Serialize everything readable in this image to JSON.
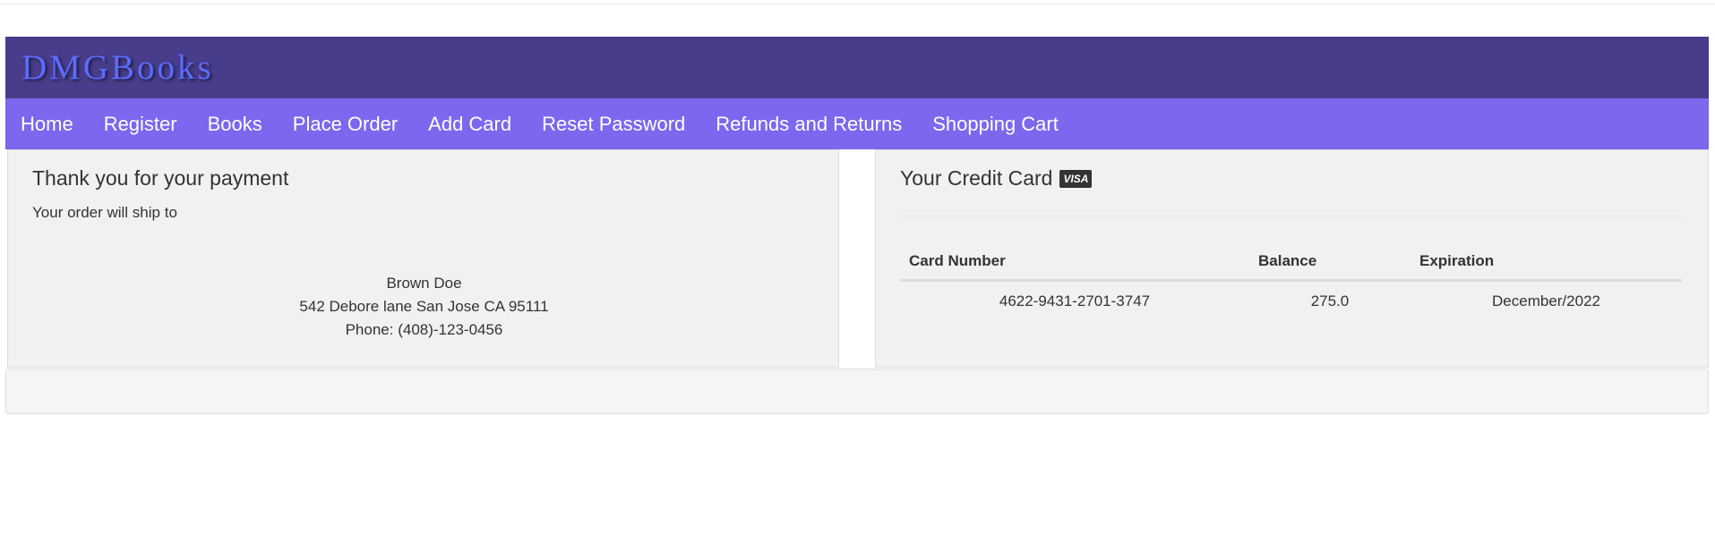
{
  "brand": {
    "name": "DMGBooks"
  },
  "nav": {
    "items": [
      {
        "label": "Home"
      },
      {
        "label": "Register"
      },
      {
        "label": "Books"
      },
      {
        "label": "Place Order"
      },
      {
        "label": "Add Card"
      },
      {
        "label": "Reset Password"
      },
      {
        "label": "Refunds and Returns"
      },
      {
        "label": "Shopping Cart"
      }
    ]
  },
  "payment": {
    "title": "Thank you for your payment",
    "ship_text": "Your order will ship to",
    "address": {
      "name": "Brown Doe",
      "street": "542 Debore lane San Jose CA 95111",
      "phone": "Phone: (408)-123-0456"
    }
  },
  "credit_card": {
    "title": "Your Credit Card",
    "icon": "visa-icon",
    "icon_text": "VISA",
    "columns": [
      "Card Number",
      "Balance",
      "Expiration"
    ],
    "rows": [
      {
        "card_number": "4622-9431-2701-3747",
        "balance": "275.0",
        "expiration": "December/2022"
      }
    ]
  },
  "colors": {
    "header_bg": "#483d8b",
    "navbar_bg": "#7b68ee",
    "brand_text": "#5b6cff",
    "panel_bg": "#f1f1f1"
  }
}
